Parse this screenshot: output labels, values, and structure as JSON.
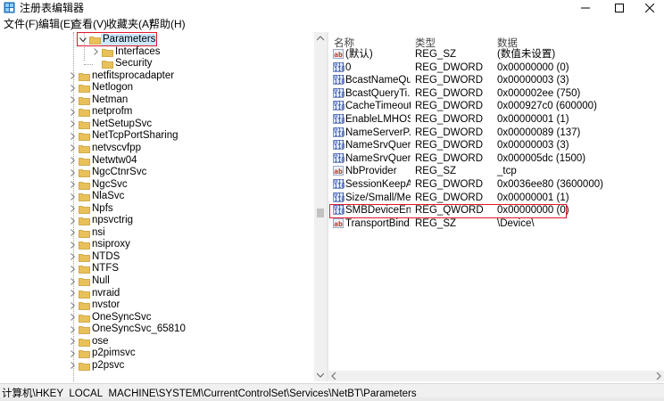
{
  "window": {
    "title": "注册表编辑器",
    "controls": {
      "minimize": "—",
      "maximize": "☐",
      "close": "✕"
    }
  },
  "menu": [
    "文件(F)",
    "编辑(E)",
    "查看(V)",
    "收藏夹(A)",
    "帮助(H)"
  ],
  "tree": {
    "selected": "Parameters",
    "items": [
      {
        "label": "Parameters",
        "expander": "expanded",
        "selected": true
      },
      {
        "label": "Interfaces",
        "expander": "collapsed"
      },
      {
        "label": "Security",
        "expander": "none"
      },
      {
        "label": "netfitsprocadapter",
        "expander": "collapsed"
      },
      {
        "label": "Netlogon",
        "expander": "collapsed"
      },
      {
        "label": "Netman",
        "expander": "collapsed"
      },
      {
        "label": "netprofm",
        "expander": "collapsed"
      },
      {
        "label": "NetSetupSvc",
        "expander": "collapsed"
      },
      {
        "label": "NetTcpPortSharing",
        "expander": "collapsed"
      },
      {
        "label": "netvscvfpp",
        "expander": "collapsed"
      },
      {
        "label": "Netwtw04",
        "expander": "collapsed"
      },
      {
        "label": "NgcCtnrSvc",
        "expander": "collapsed"
      },
      {
        "label": "NgcSvc",
        "expander": "collapsed"
      },
      {
        "label": "NlaSvc",
        "expander": "collapsed"
      },
      {
        "label": "Npfs",
        "expander": "collapsed"
      },
      {
        "label": "npsvctrig",
        "expander": "collapsed"
      },
      {
        "label": "nsi",
        "expander": "collapsed"
      },
      {
        "label": "nsiproxy",
        "expander": "collapsed"
      },
      {
        "label": "NTDS",
        "expander": "collapsed"
      },
      {
        "label": "NTFS",
        "expander": "collapsed"
      },
      {
        "label": "Null",
        "expander": "collapsed"
      },
      {
        "label": "nvraid",
        "expander": "collapsed"
      },
      {
        "label": "nvstor",
        "expander": "collapsed"
      },
      {
        "label": "OneSyncSvc",
        "expander": "collapsed"
      },
      {
        "label": "OneSyncSvc_65810",
        "expander": "collapsed"
      },
      {
        "label": "ose",
        "expander": "collapsed"
      },
      {
        "label": "p2pimsvc",
        "expander": "collapsed"
      },
      {
        "label": "p2psvc",
        "expander": "collapsed"
      }
    ]
  },
  "values": {
    "columns": {
      "name": "名称",
      "type": "类型",
      "data": "数据"
    },
    "rows": [
      {
        "icon": "string-value-icon",
        "name": "(默认)",
        "type": "REG_SZ",
        "data": "(数值未设置)"
      },
      {
        "icon": "binary-value-icon",
        "name": "0",
        "type": "REG_DWORD",
        "data": "0x00000000 (0)"
      },
      {
        "icon": "binary-value-icon",
        "name": "BcastNameQu...",
        "type": "REG_DWORD",
        "data": "0x00000003 (3)"
      },
      {
        "icon": "binary-value-icon",
        "name": "BcastQueryTi...",
        "type": "REG_DWORD",
        "data": "0x000002ee (750)"
      },
      {
        "icon": "binary-value-icon",
        "name": "CacheTimeout",
        "type": "REG_DWORD",
        "data": "0x000927c0 (600000)"
      },
      {
        "icon": "binary-value-icon",
        "name": "EnableLMHOS...",
        "type": "REG_DWORD",
        "data": "0x00000001 (1)"
      },
      {
        "icon": "binary-value-icon",
        "name": "NameServerP...",
        "type": "REG_DWORD",
        "data": "0x00000089 (137)"
      },
      {
        "icon": "binary-value-icon",
        "name": "NameSrvQuer...",
        "type": "REG_DWORD",
        "data": "0x00000003 (3)"
      },
      {
        "icon": "binary-value-icon",
        "name": "NameSrvQuer...",
        "type": "REG_DWORD",
        "data": "0x000005dc (1500)"
      },
      {
        "icon": "string-value-icon",
        "name": "NbProvider",
        "type": "REG_SZ",
        "data": "_tcp"
      },
      {
        "icon": "binary-value-icon",
        "name": "SessionKeepAl...",
        "type": "REG_DWORD",
        "data": "0x0036ee80 (3600000)"
      },
      {
        "icon": "binary-value-icon",
        "name": "Size/Small/Me...",
        "type": "REG_DWORD",
        "data": "0x00000001 (1)"
      },
      {
        "icon": "binary-value-icon",
        "name": "SMBDeviceEna...",
        "type": "REG_QWORD",
        "data": "0x00000000 (0)",
        "highlighted": true
      },
      {
        "icon": "string-value-icon",
        "name": "TransportBind...",
        "type": "REG_SZ",
        "data": "\\Device\\"
      }
    ]
  },
  "status": {
    "path": "计算机\\HKEY_LOCAL_MACHINE\\SYSTEM\\CurrentControlSet\\Services\\NetBT\\Parameters"
  },
  "colors": {
    "highlight_box": "#e0182d",
    "folder": "#e8c15a",
    "selection": "#cce8ff"
  }
}
